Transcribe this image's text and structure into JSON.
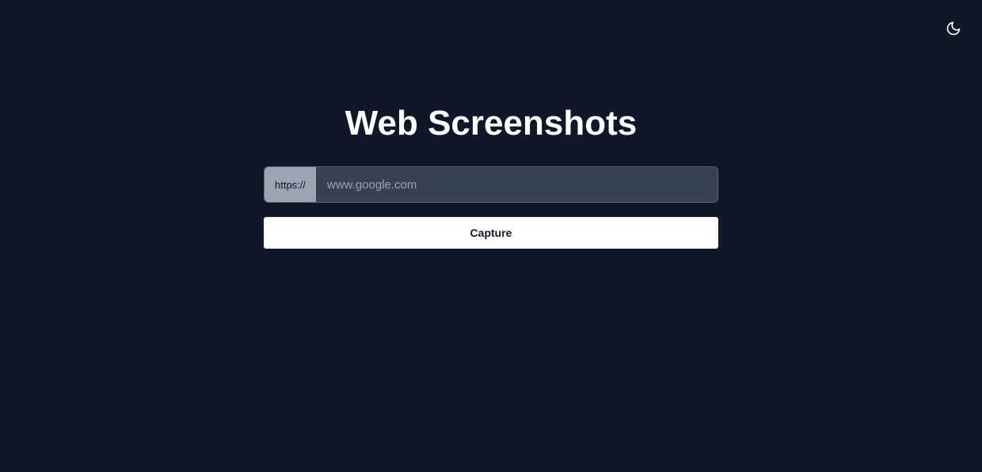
{
  "header": {
    "theme_toggle_icon": "moon-icon"
  },
  "main": {
    "title": "Web Screenshots",
    "url_prefix": "https://",
    "url_placeholder": "www.google.com",
    "url_value": "",
    "capture_label": "Capture"
  },
  "colors": {
    "background": "#111729",
    "input_bg": "#374151",
    "prefix_bg": "#9ca3b1",
    "button_bg": "#ffffff"
  }
}
